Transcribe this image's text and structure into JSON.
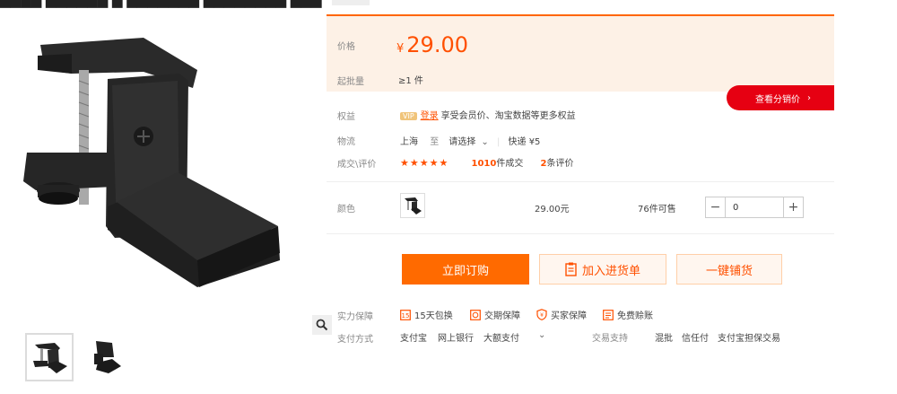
{
  "colors": {
    "accent": "#ff5000",
    "buy_button": "#ff6a00",
    "price_bg": "#fdf1e6",
    "distribution_button": "#e60012"
  },
  "price": {
    "label": "价格",
    "currency": "¥",
    "value": "29.00"
  },
  "moq": {
    "label": "起批量",
    "value": "≥1 件"
  },
  "distribution_button": "查看分销价",
  "benefits": {
    "label": "权益",
    "vip_badge": "VIP",
    "login_link": "登录",
    "text": "享受会员价、淘宝数据等更多权益"
  },
  "logistics": {
    "label": "物流",
    "from": "上海",
    "to_word": "至",
    "destination": "请选择",
    "shipping": "快递 ¥5"
  },
  "transactions": {
    "label": "成交\\评价",
    "stars": "★★★★★",
    "sold_count": "1010",
    "sold_suffix": "件成交",
    "review_count": "2",
    "review_suffix": "条评价"
  },
  "color_option": {
    "label": "颜色",
    "price": "29.00元",
    "stock": "76件可售",
    "quantity": "0"
  },
  "buttons": {
    "buy_now": "立即订购",
    "add_to_cart": "加入进货单",
    "one_click_distribute": "一键铺货"
  },
  "guarantees": {
    "label": "实力保障",
    "items": [
      "15天包换",
      "交期保障",
      "买家保障",
      "免费赊账"
    ]
  },
  "payment": {
    "label": "支付方式",
    "methods": [
      "支付宝",
      "网上银行",
      "大额支付"
    ],
    "trade_label": "交易支持",
    "trade_items": [
      "混批",
      "信任付",
      "支付宝担保交易"
    ]
  },
  "icons": [
    "zoom-icon",
    "chevron-right-icon",
    "chevron-down-icon",
    "minus-icon",
    "plus-icon",
    "clipboard-icon",
    "exchange-icon",
    "clock-icon",
    "shield-icon",
    "credit-icon"
  ]
}
